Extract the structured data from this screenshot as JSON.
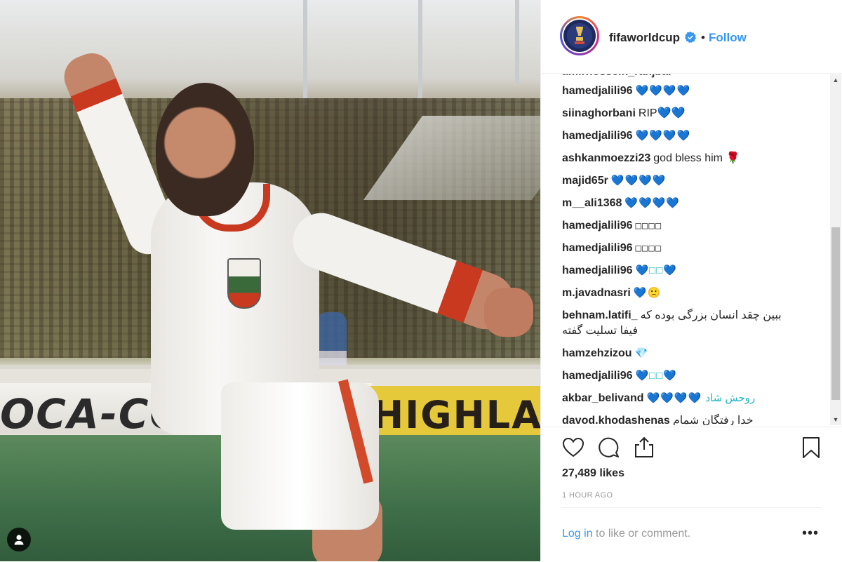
{
  "post": {
    "account": {
      "username": "fifaworldcup",
      "follow_label": "Follow",
      "separator": "•",
      "accent_color": "#3897f0"
    },
    "comments": [
      {
        "user": "hamedjalili96",
        "text": "💙💙💙💙"
      },
      {
        "user": "siinaghorbani",
        "text": "RIP💙💙"
      },
      {
        "user": "hamedjalili96",
        "text": "💙💙💙💙"
      },
      {
        "user": "ashkanmoezzi23",
        "text": "god bless him 🌹"
      },
      {
        "user": "majid65r",
        "text": "💙💙💙💙"
      },
      {
        "user": "m__ali1368",
        "text": "💙💙💙💙"
      },
      {
        "user": "hamedjalili96",
        "text": "□□□□"
      },
      {
        "user": "hamedjalili96",
        "text": "□□□□"
      },
      {
        "user": "hamedjalili96",
        "text": "💙□□💙"
      },
      {
        "user": "m.javadnasri",
        "text": "💙🙁"
      },
      {
        "user": "behnam.latifi_",
        "text": "ببین چقد انسان بزرگی بوده که فیفا تسلیت گفته"
      },
      {
        "user": "hamzehzizou",
        "text": "💎"
      },
      {
        "user": "hamedjalili96",
        "text": "💙□□💙"
      },
      {
        "user": "akbar_belivand",
        "text": "💙💙💙💙 روحش شاد"
      },
      {
        "user": "davod.khodashenas",
        "text": "خدا رفتگان شمام"
      }
    ],
    "likes_label": "27,489 likes",
    "time_label": "1 HOUR AGO",
    "login": {
      "link_text": "Log in",
      "rest_text": " to like or comment.",
      "more_label": "•••"
    },
    "icons": {
      "like": "heart-icon",
      "comment": "comment-icon",
      "share": "share-icon",
      "save": "bookmark-icon",
      "verified": "verified-badge-icon",
      "user_tag": "user-tag-icon"
    },
    "photo_signage": {
      "board_left": "OCA-CO",
      "board_right": "HIGHLA"
    }
  }
}
